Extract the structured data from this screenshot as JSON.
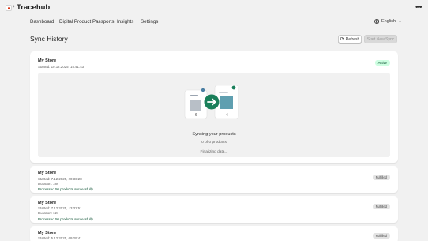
{
  "app": {
    "title": "Tracehub",
    "separator": "›"
  },
  "nav": {
    "items": [
      {
        "label": "Dashboard"
      },
      {
        "label": "Digital Product Passports"
      },
      {
        "label": "Insights"
      },
      {
        "label": "Settings"
      }
    ],
    "language": "English"
  },
  "page": {
    "title": "Sync History",
    "refresh_label": "Refresh",
    "start_label": "Start New Sync"
  },
  "current_sync": {
    "store": "My Store",
    "started": "Started: 10.12.2025, 15:41:43",
    "status": "Active",
    "progress_title": "Syncing your products",
    "progress_count": "0 of 0 products",
    "progress_status": "Finalizing data...",
    "source_count": "6",
    "target_count": "4"
  },
  "history": [
    {
      "store": "My Store",
      "started": "Started: 7.12.2025, 20:36:28",
      "duration": "Duration: 18s",
      "result": "Processed 50 products successfully",
      "status": "Fulfilled"
    },
    {
      "store": "My Store",
      "started": "Started: 7.12.2025, 13:32:51",
      "duration": "Duration: 12s",
      "result": "Processed 50 products successfully",
      "status": "Fulfilled"
    },
    {
      "store": "My Store",
      "started": "Started: 5.12.2025, 09:29:41",
      "status": "Fulfilled"
    }
  ],
  "colors": {
    "background": "#f1f1f1",
    "active_badge": "#cdfee1",
    "success_text": "#0c5132",
    "sync_accent": "#1a7f5a"
  }
}
